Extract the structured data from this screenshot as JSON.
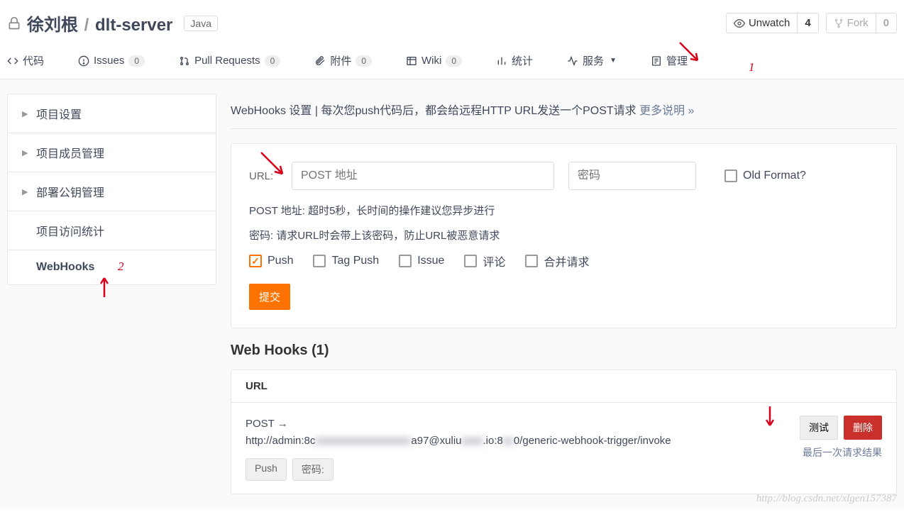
{
  "header": {
    "owner": "徐刘根",
    "sep": "/",
    "repo": "dlt-server",
    "language": "Java",
    "unwatch_label": "Unwatch",
    "unwatch_count": "4",
    "fork_label": "Fork",
    "fork_count": "0"
  },
  "nav": {
    "code": "代码",
    "issues": "Issues",
    "issues_count": "0",
    "pr": "Pull Requests",
    "pr_count": "0",
    "attach": "附件",
    "attach_count": "0",
    "wiki": "Wiki",
    "wiki_count": "0",
    "stats": "统计",
    "services": "服务",
    "manage": "管理"
  },
  "sidebar": {
    "project_settings": "项目设置",
    "member_manage": "项目成员管理",
    "deploy_key": "部署公钥管理",
    "access_stats": "项目访问统计",
    "webhooks": "WebHooks"
  },
  "page": {
    "title_prefix": "WebHooks 设置 | 每次您push代码后，都会给远程HTTP URL发送一个POST请求",
    "more_link": "更多说明 »"
  },
  "form": {
    "url_label": "URL:",
    "url_placeholder": "POST 地址",
    "pwd_placeholder": "密码",
    "old_format": "Old Format?",
    "help_post": "POST 地址: 超时5秒，长时间的操作建议您异步进行",
    "help_pwd": "密码: 请求URL时会带上该密码，防止URL被恶意请求",
    "cb_push": "Push",
    "cb_tag": "Tag Push",
    "cb_issue": "Issue",
    "cb_comment": "评论",
    "cb_mr": "合并请求",
    "submit": "提交"
  },
  "hooks": {
    "title": "Web Hooks (1)",
    "col_url": "URL",
    "row": {
      "method": "POST →",
      "url_p1": "http://admin:8c",
      "url_p2": "xxxxxxxxxxxxxxxxxx",
      "url_p3": "a97@xuliu",
      "url_p4": "xxxx",
      "url_p5": ".io:8",
      "url_p6": "xx",
      "url_p7": "0/generic-webhook-trigger/invoke",
      "tag_push": "Push",
      "tag_pwd": "密码:",
      "btn_test": "测试",
      "btn_delete": "删除",
      "result_link": "最后一次请求结果"
    }
  },
  "annotations": {
    "num1": "1",
    "num2": "2"
  },
  "watermark": "http://blog.csdn.net/xlgen157387"
}
